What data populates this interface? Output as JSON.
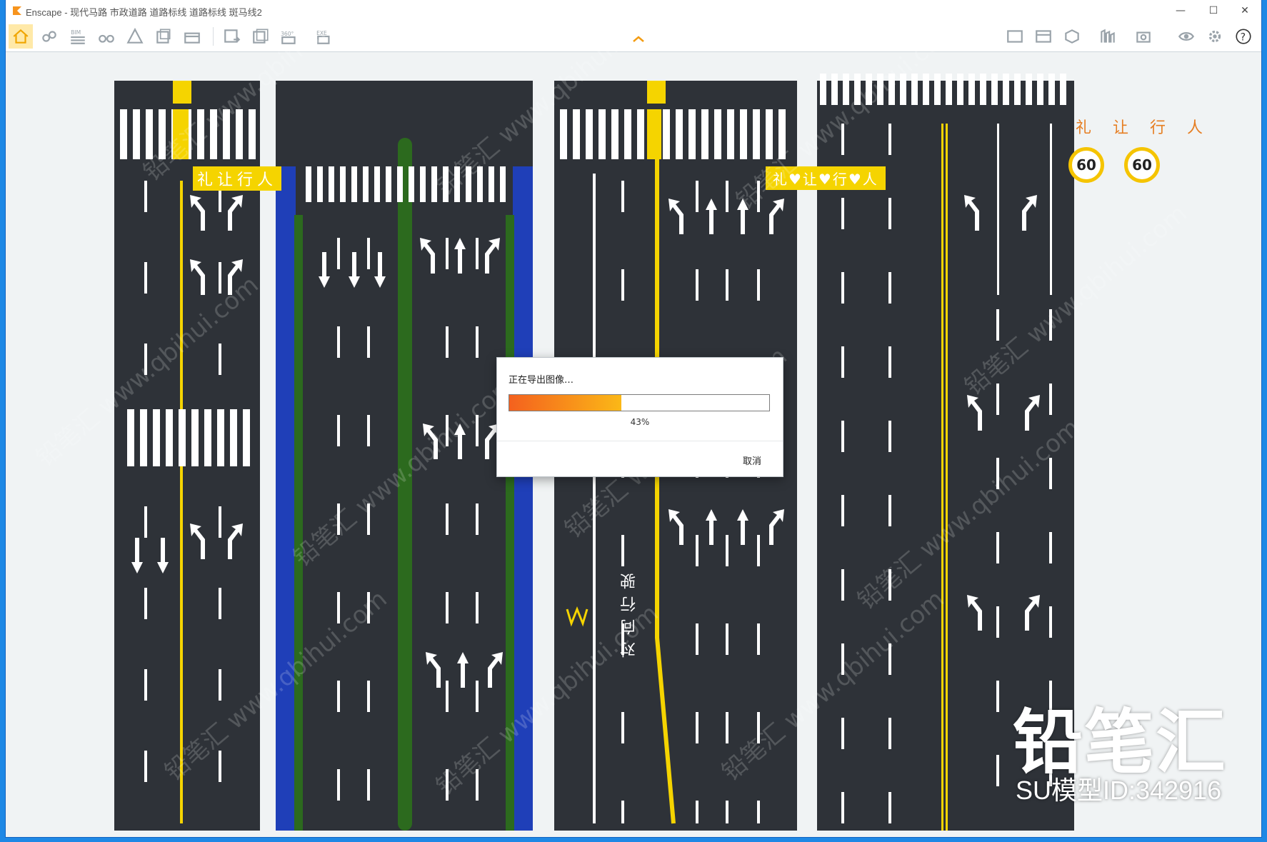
{
  "window": {
    "title": "Enscape - 现代马路 市政道路 道路标线 道路标线 斑马线2",
    "controls": {
      "minimize": "—",
      "maximize": "☐",
      "close": "✕"
    }
  },
  "toolbar": {
    "left_buttons": [
      "home-icon",
      "link-icon",
      "bim-icon",
      "binoculars-icon",
      "asset-icon",
      "cube-views-icon",
      "floorplan-icon",
      "screenshot-icon",
      "batch-render-icon",
      "panorama-icon",
      "exe-export-icon"
    ],
    "right_buttons": [
      "views-icon",
      "gallery-icon",
      "material-icon",
      "asset-library-icon",
      "capture-icon",
      "visual-settings-icon",
      "settings-icon",
      "help-icon"
    ],
    "bim_label": "BIM",
    "panorama_label": "360°",
    "exe_label": "EXE",
    "help_label": "?"
  },
  "scene": {
    "panel1": {
      "label": "礼让行人"
    },
    "panel3": {
      "label": "礼♥让♥行♥人",
      "side_text": "对向行驶"
    },
    "panel4": {
      "label": "礼让行人",
      "speed_left": "60",
      "speed_right": "60"
    },
    "colors": {
      "asphalt": "#2e3238",
      "marking_yellow": "#f5d400",
      "bike_lane": "#1f3fb8",
      "green_strip": "#2c6a1e"
    }
  },
  "watermark": {
    "brand": "铅笔汇",
    "model_id": "SU模型ID:342916",
    "diagonal": "铅笔汇 www.qbihui.com"
  },
  "dialog": {
    "title": "正在导出图像…",
    "progress": 0.43,
    "progress_label": "43%",
    "cancel_label": "取消"
  }
}
